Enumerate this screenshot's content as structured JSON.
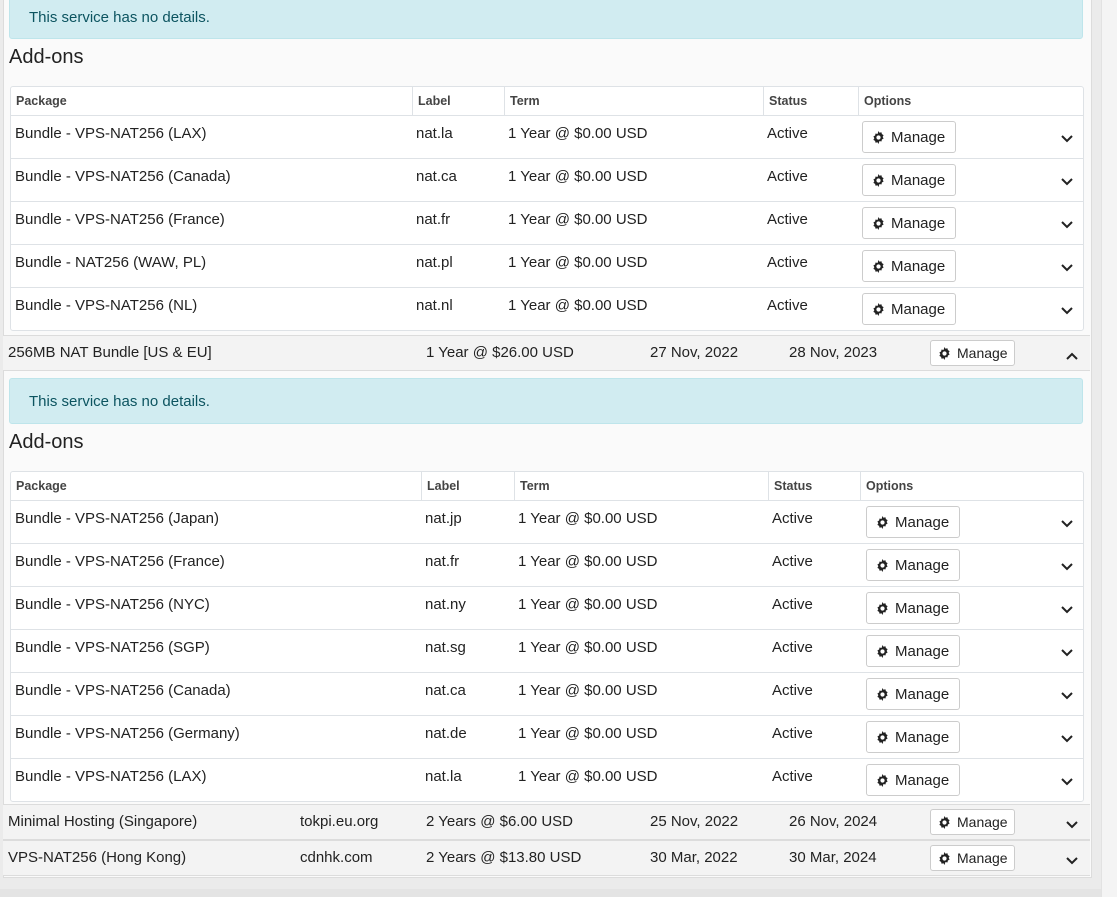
{
  "first_block": {
    "notice": "This service has no details.",
    "addons_title": "Add-ons",
    "headers": [
      "Package",
      "Label",
      "Term",
      "Status",
      "Options"
    ],
    "rows": [
      {
        "package": "Bundle - VPS-NAT256 (LAX)",
        "label": "nat.la",
        "term": "1 Year @ $0.00 USD",
        "status": "Active",
        "action": "Manage"
      },
      {
        "package": "Bundle - VPS-NAT256 (Canada)",
        "label": "nat.ca",
        "term": "1 Year @ $0.00 USD",
        "status": "Active",
        "action": "Manage"
      },
      {
        "package": "Bundle - VPS-NAT256 (France)",
        "label": "nat.fr",
        "term": "1 Year @ $0.00 USD",
        "status": "Active",
        "action": "Manage"
      },
      {
        "package": "Bundle - NAT256 (WAW, PL)",
        "label": "nat.pl",
        "term": "1 Year @ $0.00 USD",
        "status": "Active",
        "action": "Manage"
      },
      {
        "package": "Bundle - VPS-NAT256 (NL)",
        "label": "nat.nl",
        "term": "1 Year @ $0.00 USD",
        "status": "Active",
        "action": "Manage"
      }
    ]
  },
  "services": [
    {
      "name": "256MB NAT Bundle [US & EU]",
      "domain": "",
      "term": "1 Year @ $26.00 USD",
      "reg_date": "27 Nov, 2022",
      "due_date": "28 Nov, 2023",
      "action": "Manage",
      "expanded": true
    },
    {
      "name": "Minimal Hosting (Singapore)",
      "domain": "tokpi.eu.org",
      "term": "2 Years @ $6.00 USD",
      "reg_date": "25 Nov, 2022",
      "due_date": "26 Nov, 2024",
      "action": "Manage",
      "expanded": false
    },
    {
      "name": "VPS-NAT256 (Hong Kong)",
      "domain": "cdnhk.com",
      "term": "2 Years @ $13.80 USD",
      "reg_date": "30 Mar, 2022",
      "due_date": "30 Mar, 2024",
      "action": "Manage",
      "expanded": false
    }
  ],
  "second_block": {
    "notice": "This service has no details.",
    "addons_title": "Add-ons",
    "headers": [
      "Package",
      "Label",
      "Term",
      "Status",
      "Options"
    ],
    "rows": [
      {
        "package": "Bundle - VPS-NAT256 (Japan)",
        "label": "nat.jp",
        "term": "1 Year @ $0.00 USD",
        "status": "Active",
        "action": "Manage"
      },
      {
        "package": "Bundle - VPS-NAT256 (France)",
        "label": "nat.fr",
        "term": "1 Year @ $0.00 USD",
        "status": "Active",
        "action": "Manage"
      },
      {
        "package": "Bundle - VPS-NAT256 (NYC)",
        "label": "nat.ny",
        "term": "1 Year @ $0.00 USD",
        "status": "Active",
        "action": "Manage"
      },
      {
        "package": "Bundle - VPS-NAT256 (SGP)",
        "label": "nat.sg",
        "term": "1 Year @ $0.00 USD",
        "status": "Active",
        "action": "Manage"
      },
      {
        "package": "Bundle - VPS-NAT256 (Canada)",
        "label": "nat.ca",
        "term": "1 Year @ $0.00 USD",
        "status": "Active",
        "action": "Manage"
      },
      {
        "package": "Bundle - VPS-NAT256 (Germany)",
        "label": "nat.de",
        "term": "1 Year @ $0.00 USD",
        "status": "Active",
        "action": "Manage"
      },
      {
        "package": "Bundle - VPS-NAT256 (LAX)",
        "label": "nat.la",
        "term": "1 Year @ $0.00 USD",
        "status": "Active",
        "action": "Manage"
      }
    ]
  },
  "icons": {
    "manage": "gear-icon",
    "expand": "chevron-down-icon",
    "collapse": "chevron-up-icon"
  }
}
